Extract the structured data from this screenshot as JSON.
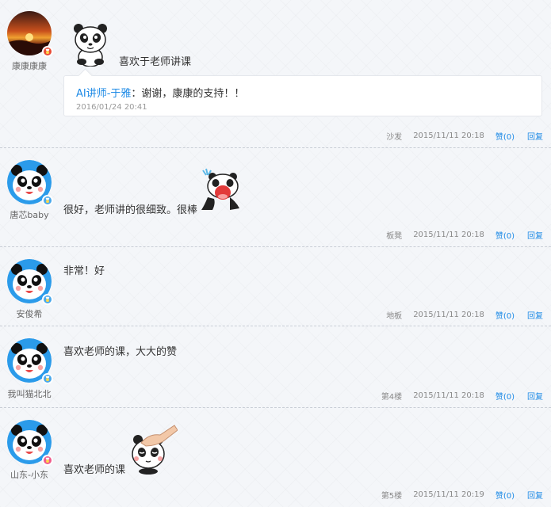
{
  "colors": {
    "link": "#1d8ae6",
    "badge_red": "#e94b35",
    "badge_blue": "#4aa8ec",
    "badge_pink": "#f05a8c"
  },
  "comments": [
    {
      "username": "康康康康",
      "badge_icon": "medal-icon",
      "text": "喜欢于老师讲课",
      "reply": {
        "author": "AI讲师-于雅",
        "text": "：谢谢，康康的支持！！",
        "time": "2016/01/24 20:41"
      },
      "floor": "沙发",
      "time": "2015/11/11 20:18",
      "like": "赞(0)",
      "reply_label": "回复"
    },
    {
      "username": "唐芯baby",
      "badge_icon": "medal-icon",
      "text": "很好，老师讲的很细致。很棒",
      "floor": "板凳",
      "time": "2015/11/11 20:18",
      "like": "赞(0)",
      "reply_label": "回复"
    },
    {
      "username": "安俊希",
      "badge_icon": "medal-icon",
      "text": "非常！好",
      "floor": "地板",
      "time": "2015/11/11 20:18",
      "like": "赞(0)",
      "reply_label": "回复"
    },
    {
      "username": "我叫猫北北",
      "badge_icon": "medal-icon",
      "text": "喜欢老师的课，大大的赞",
      "floor": "第4楼",
      "time": "2015/11/11 20:18",
      "like": "赞(0)",
      "reply_label": "回复"
    },
    {
      "username": "山东-小东",
      "badge_icon": "medal-icon",
      "text": "喜欢老师的课",
      "floor": "第5楼",
      "time": "2015/11/11 20:19",
      "like": "赞(0)",
      "reply_label": "回复"
    }
  ]
}
